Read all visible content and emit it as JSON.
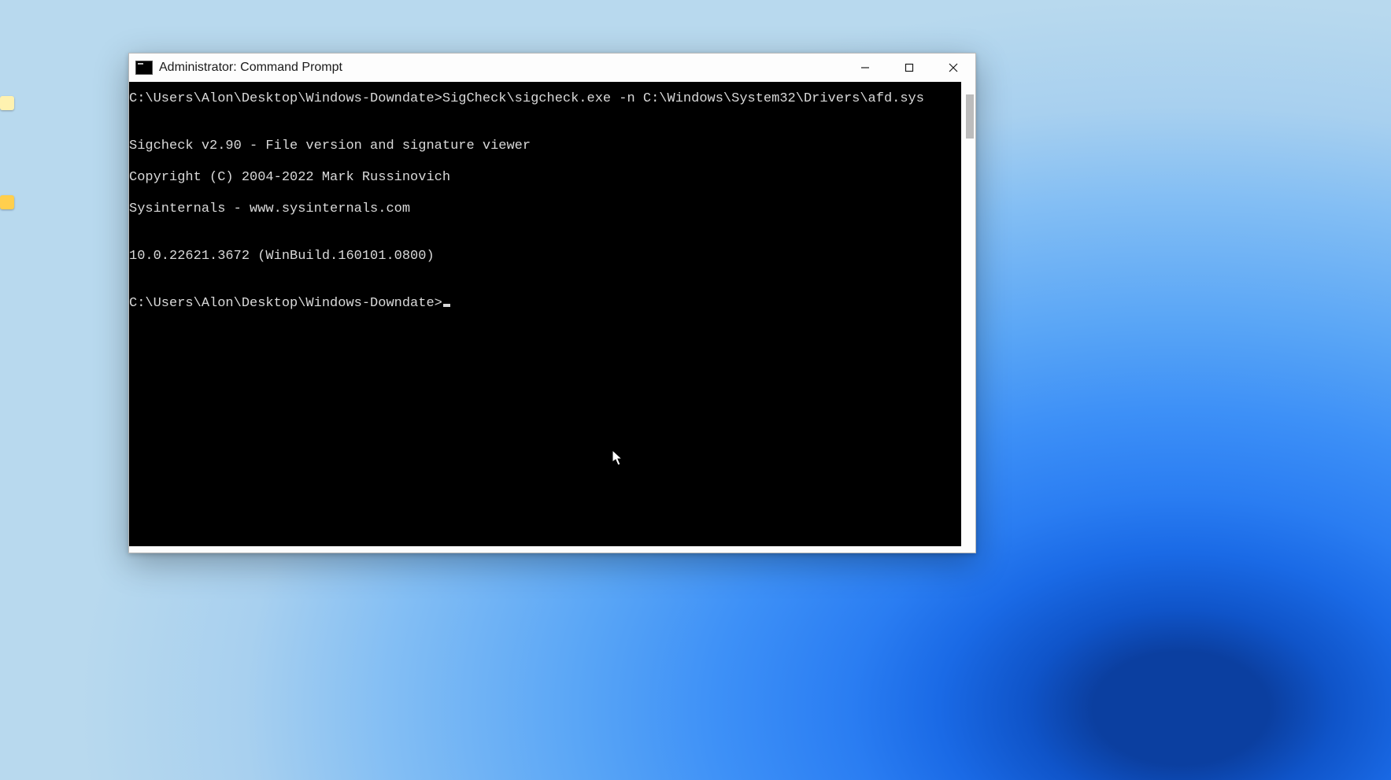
{
  "window": {
    "title": "Administrator: Command Prompt"
  },
  "terminal": {
    "lines": {
      "l0": "C:\\Users\\Alon\\Desktop\\Windows-Downdate>SigCheck\\sigcheck.exe -n C:\\Windows\\System32\\Drivers\\afd.sys",
      "l1": "",
      "l2": "Sigcheck v2.90 - File version and signature viewer",
      "l3": "Copyright (C) 2004-2022 Mark Russinovich",
      "l4": "Sysinternals - www.sysinternals.com",
      "l5": "",
      "l6": "10.0.22621.3672 (WinBuild.160101.0800)",
      "l7": "",
      "l8": "C:\\Users\\Alon\\Desktop\\Windows-Downdate>"
    }
  }
}
